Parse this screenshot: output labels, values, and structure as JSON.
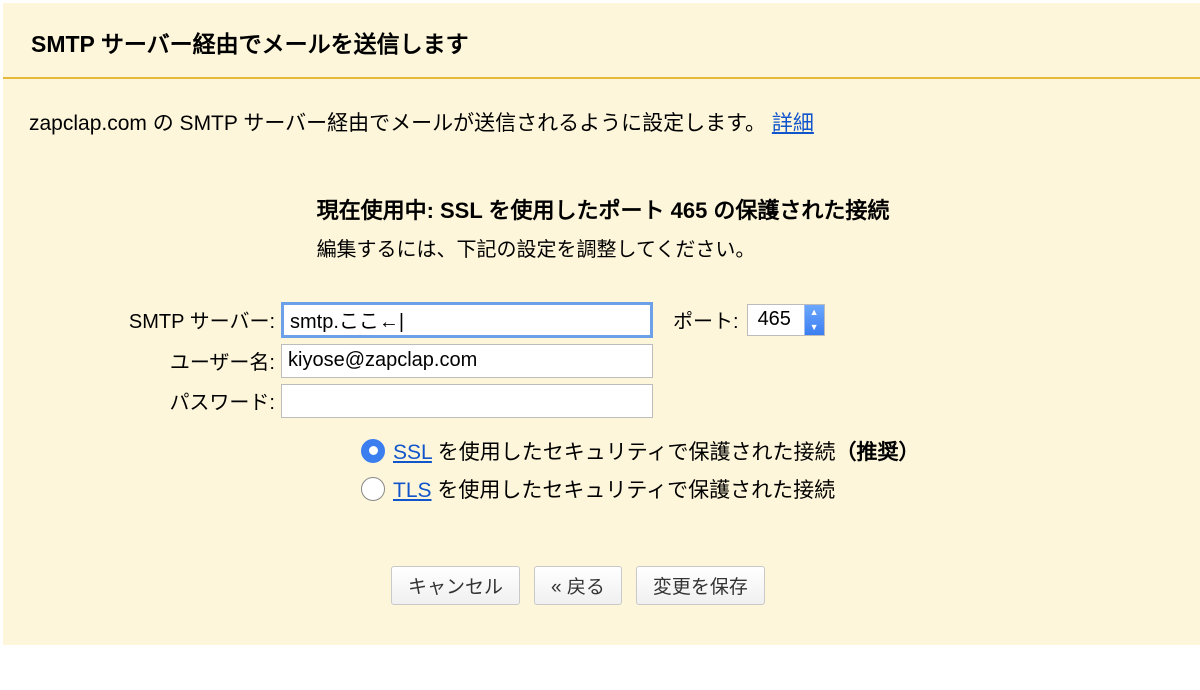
{
  "title": "SMTP サーバー経由でメールを送信します",
  "description_text": "zapclap.com の SMTP サーバー経由でメールが送信されるように設定します。",
  "description_link": "詳細",
  "status": {
    "current": "現在使用中: SSL を使用したポート 465 の保護された接続",
    "edit_hint": "編集するには、下記の設定を調整してください。"
  },
  "form": {
    "smtp_label": "SMTP サーバー:",
    "smtp_value": "smtp.ここ←|",
    "port_label": "ポート:",
    "port_value": "465",
    "user_label": "ユーザー名:",
    "user_value": "kiyose@zapclap.com",
    "pass_label": "パスワード:",
    "pass_value": ""
  },
  "security": {
    "ssl_proto": "SSL",
    "ssl_rest": " を使用したセキュリティで保護された接続",
    "ssl_recommended": "（推奨）",
    "tls_proto": "TLS",
    "tls_rest": " を使用したセキュリティで保護された接続",
    "selected": "ssl"
  },
  "buttons": {
    "cancel": "キャンセル",
    "back": "« 戻る",
    "save": "変更を保存"
  }
}
